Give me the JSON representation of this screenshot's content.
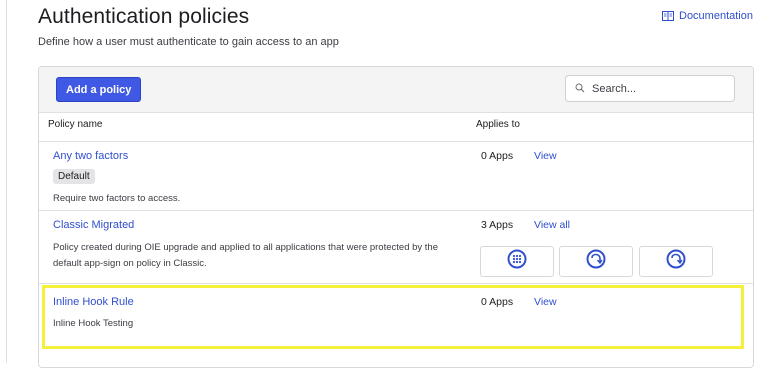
{
  "header": {
    "title": "Authentication policies",
    "subtitle": "Define how a user must authenticate to gain access to an app",
    "documentation_label": "Documentation",
    "documentation_icon": "book-icon"
  },
  "toolbar": {
    "add_label": "Add a policy",
    "search_placeholder": "Search...",
    "search_value": "",
    "search_icon": "search-icon"
  },
  "table": {
    "columns": [
      "Policy name",
      "Applies to"
    ],
    "rows": [
      {
        "name": "Any two factors",
        "badge": "Default",
        "description": "Require two factors to access.",
        "apps": "0 Apps",
        "action": "View"
      },
      {
        "name": "Classic Migrated",
        "description_line1": "Policy created during OIE upgrade and applied to all applications that were protected by the",
        "description_line2": "default app-sign on policy in Classic.",
        "apps": "3 Apps",
        "action": "View all",
        "app_icons": [
          "grid-dots-icon",
          "refresh-arrow-icon",
          "refresh-arrow-icon"
        ]
      },
      {
        "name": "Inline Hook Rule",
        "description": "Inline Hook Testing",
        "apps": "0 Apps",
        "action": "View"
      }
    ]
  },
  "colors": {
    "accent": "#3f59e4",
    "link": "#2f4fcf",
    "highlight": "#f5f03a"
  }
}
